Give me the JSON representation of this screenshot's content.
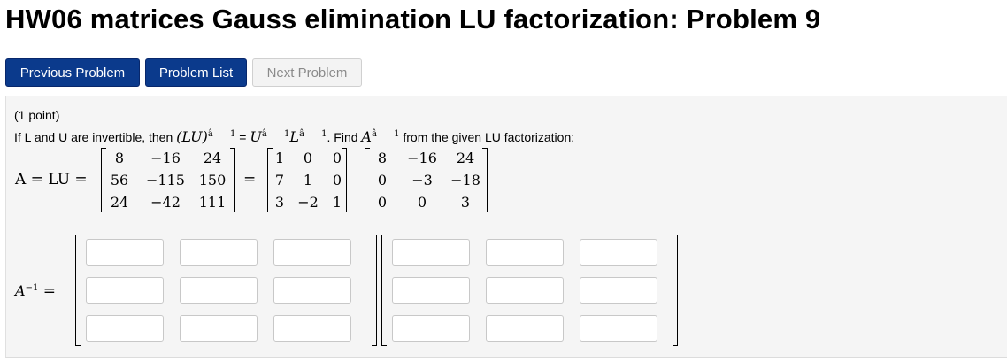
{
  "page_title": "HW06 matrices Gauss elimination LU factorization: Problem 9",
  "nav": {
    "previous_label": "Previous Problem",
    "list_label": "Problem List",
    "next_label": "Next Problem"
  },
  "problem": {
    "points": "(1 point)",
    "statement_prefix": "If L and U are invertible, then",
    "lu_expr": "(LU)",
    "exp_garbled": "â 1",
    "equals_text": "=",
    "u_sym": "U",
    "l_sym": "L",
    "find_text": ". Find",
    "a_sym": "A",
    "statement_suffix": "from the given LU factorization:"
  },
  "equation": {
    "lhs_label": "A = LU =",
    "equals": "=",
    "A": [
      [
        "8",
        "−16",
        "24"
      ],
      [
        "56",
        "−115",
        "150"
      ],
      [
        "24",
        "−42",
        "111"
      ]
    ],
    "L": [
      [
        "1",
        "0",
        "0"
      ],
      [
        "7",
        "1",
        "0"
      ],
      [
        "3",
        "−2",
        "1"
      ]
    ],
    "U": [
      [
        "8",
        "−16",
        "24"
      ],
      [
        "0",
        "−3",
        "−18"
      ],
      [
        "0",
        "0",
        "3"
      ]
    ]
  },
  "answer": {
    "label": "A",
    "label_exp": "−1",
    "label_eq": "=",
    "rows": 3,
    "cols": 3,
    "values": [
      "",
      "",
      "",
      "",
      "",
      "",
      "",
      "",
      "",
      "",
      "",
      "",
      "",
      "",
      "",
      "",
      "",
      ""
    ]
  },
  "colors": {
    "primary_button": "#0b3a8c",
    "disabled_button": "#f3f3f3",
    "panel_bg": "#f5f5f5"
  }
}
